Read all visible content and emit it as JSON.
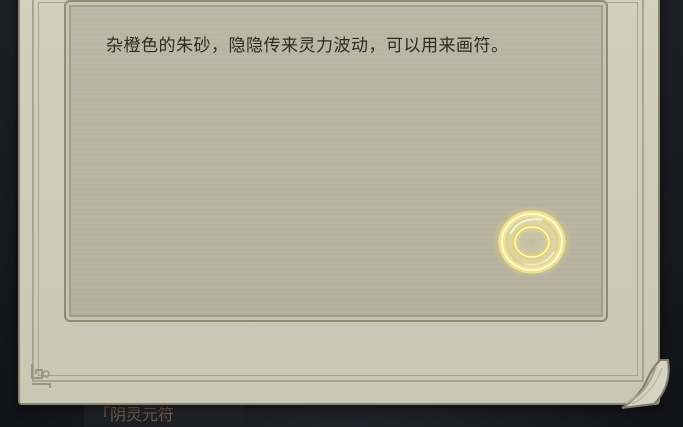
{
  "item_description": "杂橙色的朱砂，隐隐传来灵力波动，可以用来画符。",
  "background_tab": {
    "label": "「阴灵元符"
  },
  "icons": {
    "item": "cinnabar-spirit-orb-icon",
    "corner": "corner-ornament-icon",
    "curl": "page-curl-icon"
  }
}
